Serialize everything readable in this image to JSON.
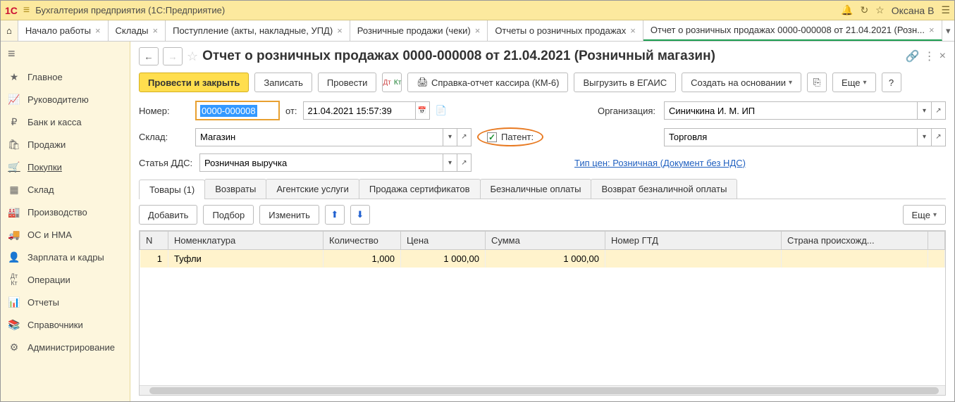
{
  "titlebar": {
    "app_title": "Бухгалтерия предприятия (1С:Предприятие)",
    "user": "Оксана В"
  },
  "tabs": [
    {
      "label": "Начало работы"
    },
    {
      "label": "Склады"
    },
    {
      "label": "Поступление (акты, накладные, УПД)"
    },
    {
      "label": "Розничные продажи (чеки)"
    },
    {
      "label": "Отчеты о розничных продажах"
    },
    {
      "label": "Отчет о розничных продажах 0000-000008 от 21.04.2021 (Розн...",
      "active": true
    }
  ],
  "sidebar": {
    "items": [
      {
        "icon": "★",
        "label": "Главное"
      },
      {
        "icon": "📈",
        "label": "Руководителю"
      },
      {
        "icon": "₽",
        "label": "Банк и касса"
      },
      {
        "icon": "🛍",
        "label": "Продажи"
      },
      {
        "icon": "🛒",
        "label": "Покупки",
        "active": true
      },
      {
        "icon": "▦",
        "label": "Склад"
      },
      {
        "icon": "🏭",
        "label": "Производство"
      },
      {
        "icon": "🚚",
        "label": "ОС и НМА"
      },
      {
        "icon": "👤",
        "label": "Зарплата и кадры"
      },
      {
        "icon": "Дт Кт",
        "label": "Операции"
      },
      {
        "icon": "📊",
        "label": "Отчеты"
      },
      {
        "icon": "📚",
        "label": "Справочники"
      },
      {
        "icon": "⚙",
        "label": "Администрирование"
      }
    ]
  },
  "page": {
    "title": "Отчет о розничных продажах 0000-000008 от 21.04.2021 (Розничный магазин)"
  },
  "toolbar": {
    "post_close": "Провести и закрыть",
    "save": "Записать",
    "post": "Провести",
    "dtkt": "Дт Кт",
    "report": "Справка-отчет кассира (КМ-6)",
    "egais": "Выгрузить в ЕГАИС",
    "create_based": "Создать на основании",
    "more": "Еще"
  },
  "form": {
    "number_label": "Номер:",
    "number_value": "0000-000008",
    "from_label": "от:",
    "date_value": "21.04.2021 15:57:39",
    "org_label": "Организация:",
    "org_value": "Синичкина И. М. ИП",
    "warehouse_label": "Склад:",
    "warehouse_value": "Магазин",
    "patent_label": "Патент:",
    "patent_value": "Торговля",
    "dds_label": "Статья ДДС:",
    "dds_value": "Розничная выручка",
    "price_type_link": "Тип цен: Розничная (Документ без НДС)"
  },
  "subtabs": [
    {
      "label": "Товары (1)",
      "active": true
    },
    {
      "label": "Возвраты"
    },
    {
      "label": "Агентские услуги"
    },
    {
      "label": "Продажа сертификатов"
    },
    {
      "label": "Безналичные оплаты"
    },
    {
      "label": "Возврат безналичной оплаты"
    }
  ],
  "subtoolbar": {
    "add": "Добавить",
    "pick": "Подбор",
    "change": "Изменить",
    "more": "Еще"
  },
  "table": {
    "columns": [
      "N",
      "Номенклатура",
      "Количество",
      "Цена",
      "Сумма",
      "Номер ГТД",
      "Страна происхожд..."
    ],
    "rows": [
      {
        "n": "1",
        "name": "Туфли",
        "qty": "1,000",
        "price": "1 000,00",
        "sum": "1 000,00",
        "gtd": "",
        "country": ""
      }
    ]
  }
}
